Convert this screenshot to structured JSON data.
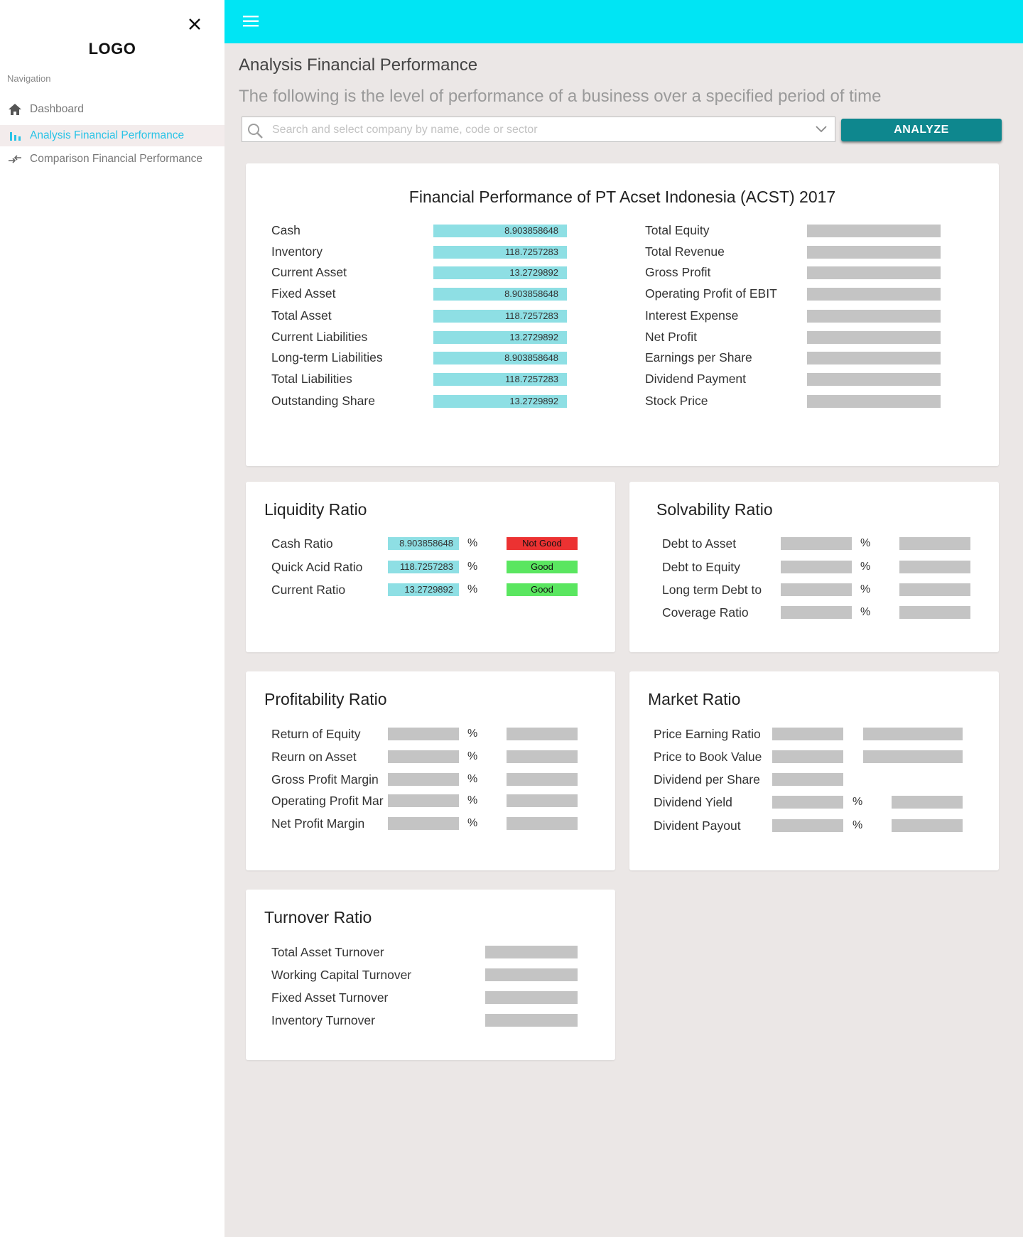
{
  "sidebar": {
    "logo": "LOGO",
    "nav_title": "Navigation",
    "items": [
      {
        "label": "Dashboard"
      },
      {
        "label": "Analysis Financial Performance"
      },
      {
        "label": "Comparison Financial Performance"
      }
    ]
  },
  "header": {
    "title": "Analysis Financial Performance",
    "subtitle": "The following is the level of performance of a business over a specified period of time"
  },
  "search": {
    "placeholder": "Search and select company by name, code or sector",
    "button_label": "ANALYZE"
  },
  "performance": {
    "title": "Financial Performance of PT Acset Indonesia (ACST) 2017",
    "left": [
      {
        "label": "Cash",
        "value": "8.903858648"
      },
      {
        "label": "Inventory",
        "value": "118.7257283"
      },
      {
        "label": "Current Asset",
        "value": "13.2729892"
      },
      {
        "label": "Fixed Asset",
        "value": "8.903858648"
      },
      {
        "label": "Total Asset",
        "value": "118.7257283"
      },
      {
        "label": "Current Liabilities",
        "value": "13.2729892"
      },
      {
        "label": "Long-term Liabilities",
        "value": "8.903858648"
      },
      {
        "label": "Total Liabilities",
        "value": "118.7257283"
      },
      {
        "label": "Outstanding Share",
        "value": "13.2729892"
      }
    ],
    "right": [
      {
        "label": "Total Equity"
      },
      {
        "label": "Total Revenue"
      },
      {
        "label": "Gross Profit"
      },
      {
        "label": "Operating Profit of EBIT"
      },
      {
        "label": "Interest Expense"
      },
      {
        "label": "Net Profit"
      },
      {
        "label": "Earnings per Share"
      },
      {
        "label": "Dividend Payment"
      },
      {
        "label": "Stock Price"
      }
    ]
  },
  "liquidity": {
    "title": "Liquidity Ratio",
    "rows": [
      {
        "label": "Cash Ratio",
        "value": "8.903858648",
        "unit": "%",
        "status": "Not Good"
      },
      {
        "label": "Quick Acid Ratio",
        "value": "118.7257283",
        "unit": "%",
        "status": "Good"
      },
      {
        "label": "Current Ratio",
        "value": "13.2729892",
        "unit": "%",
        "status": "Good"
      }
    ],
    "status_colors": {
      "bad": "#ec3232",
      "good": "#5ae660"
    }
  },
  "solvability": {
    "title": "Solvability Ratio",
    "rows": [
      {
        "label": "Debt to Asset",
        "unit": "%"
      },
      {
        "label": "Debt to Equity",
        "unit": "%"
      },
      {
        "label": "Long term Debt to",
        "unit": "%"
      },
      {
        "label": "Coverage Ratio",
        "unit": "%"
      }
    ]
  },
  "profitability": {
    "title": "Profitability Ratio",
    "rows": [
      {
        "label": "Return of Equity",
        "unit": "%"
      },
      {
        "label": "Reurn on Asset",
        "unit": "%"
      },
      {
        "label": "Gross Profit Margin",
        "unit": "%"
      },
      {
        "label": "Operating Profit Mar",
        "unit": "%"
      },
      {
        "label": "Net Profit Margin",
        "unit": "%"
      }
    ]
  },
  "market": {
    "title": "Market Ratio",
    "rows": [
      {
        "label": "Price Earning Ratio"
      },
      {
        "label": "Price to Book Value"
      },
      {
        "label": "Dividend per Share"
      },
      {
        "label": "Dividend Yield",
        "unit": "%"
      },
      {
        "label": "Divident Payout",
        "unit": "%"
      }
    ]
  },
  "turnover": {
    "title": "Turnover Ratio",
    "rows": [
      {
        "label": "Total Asset Turnover"
      },
      {
        "label": "Working Capital Turnover"
      },
      {
        "label": "Fixed Asset Turnover"
      },
      {
        "label": "Inventory Turnover"
      }
    ]
  },
  "colors": {
    "topbar": "#00e5f4",
    "accent": "#29c3e6",
    "button": "#0e878e",
    "value_bar": "#8edfe4",
    "placeholder_bar": "#c4c4c4"
  }
}
